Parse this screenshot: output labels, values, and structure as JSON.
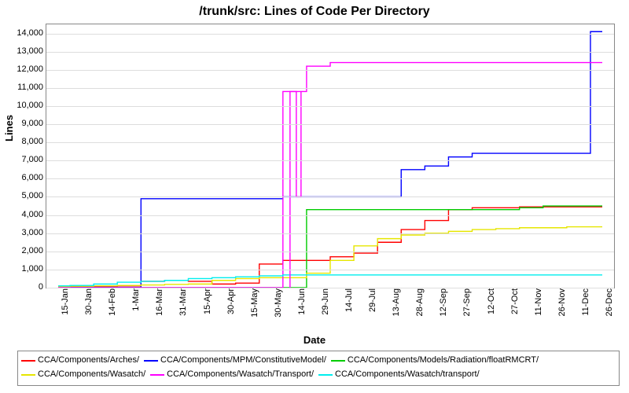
{
  "title": "/trunk/src: Lines of Code Per Directory",
  "ylabel": "Lines",
  "xlabel": "Date",
  "chart_data": {
    "type": "line",
    "ylim": [
      0,
      14500
    ],
    "ytick_values": [
      0,
      1000,
      2000,
      3000,
      4000,
      5000,
      6000,
      7000,
      8000,
      9000,
      10000,
      11000,
      12000,
      13000,
      14000
    ],
    "ytick_labels": [
      "0",
      "1,000",
      "2,000",
      "3,000",
      "4,000",
      "5,000",
      "6,000",
      "7,000",
      "8,000",
      "9,000",
      "10,000",
      "11,000",
      "12,000",
      "13,000",
      "14,000"
    ],
    "x_categories": [
      "15-Jan",
      "30-Jan",
      "14-Feb",
      "1-Mar",
      "16-Mar",
      "31-Mar",
      "15-Apr",
      "30-Apr",
      "15-May",
      "30-May",
      "14-Jun",
      "29-Jun",
      "14-Jul",
      "29-Jul",
      "13-Aug",
      "28-Aug",
      "12-Sep",
      "27-Sep",
      "12-Oct",
      "27-Oct",
      "11-Nov",
      "26-Nov",
      "11-Dec",
      "26-Dec"
    ],
    "series": [
      {
        "name": "CCA/Components/Arches/",
        "color": "#ff0000",
        "values": [
          50,
          60,
          80,
          100,
          350,
          400,
          350,
          200,
          250,
          1300,
          1500,
          1500,
          1700,
          1900,
          2500,
          3200,
          3700,
          4300,
          4400,
          4400,
          4450,
          4450,
          4450,
          4450
        ]
      },
      {
        "name": "CCA/Components/MPM/ConstitutiveModel/",
        "color": "#0000ff",
        "values": [
          20,
          20,
          20,
          20,
          4900,
          4900,
          4900,
          4900,
          4900,
          4900,
          5000,
          5000,
          5000,
          5000,
          5000,
          6500,
          6700,
          7200,
          7400,
          7400,
          7400,
          7400,
          7400,
          14100
        ]
      },
      {
        "name": "CCA/Components/Models/Radiation/floatRMCRT/",
        "color": "#00cc00",
        "values": [
          0,
          0,
          0,
          0,
          0,
          0,
          0,
          0,
          0,
          0,
          0,
          4300,
          4300,
          4300,
          4300,
          4300,
          4300,
          4300,
          4300,
          4300,
          4400,
          4500,
          4500,
          4500
        ]
      },
      {
        "name": "CCA/Components/Wasatch/",
        "color": "#e6e600",
        "values": [
          60,
          80,
          100,
          120,
          150,
          180,
          200,
          400,
          500,
          550,
          550,
          800,
          1500,
          2300,
          2700,
          2900,
          3000,
          3100,
          3200,
          3250,
          3300,
          3300,
          3350,
          3350
        ]
      },
      {
        "name": "CCA/Components/Wasatch/Transport/",
        "color": "#ff00ff",
        "values": [
          0,
          0,
          0,
          0,
          0,
          0,
          0,
          0,
          0,
          0,
          10800,
          12200,
          12400,
          12400,
          12400,
          12400,
          12400,
          12400,
          12400,
          12400,
          12400,
          12400,
          12400,
          12400
        ]
      },
      {
        "name": "CCA/Components/Wasatch/transport/",
        "color": "#00eeee",
        "values": [
          100,
          120,
          200,
          300,
          350,
          400,
          500,
          550,
          600,
          650,
          700,
          700,
          700,
          700,
          700,
          700,
          700,
          700,
          700,
          700,
          700,
          700,
          700,
          700
        ]
      }
    ],
    "magenta_pre_spike": {
      "x_index": 10,
      "low": 5000,
      "high": 10800
    }
  }
}
